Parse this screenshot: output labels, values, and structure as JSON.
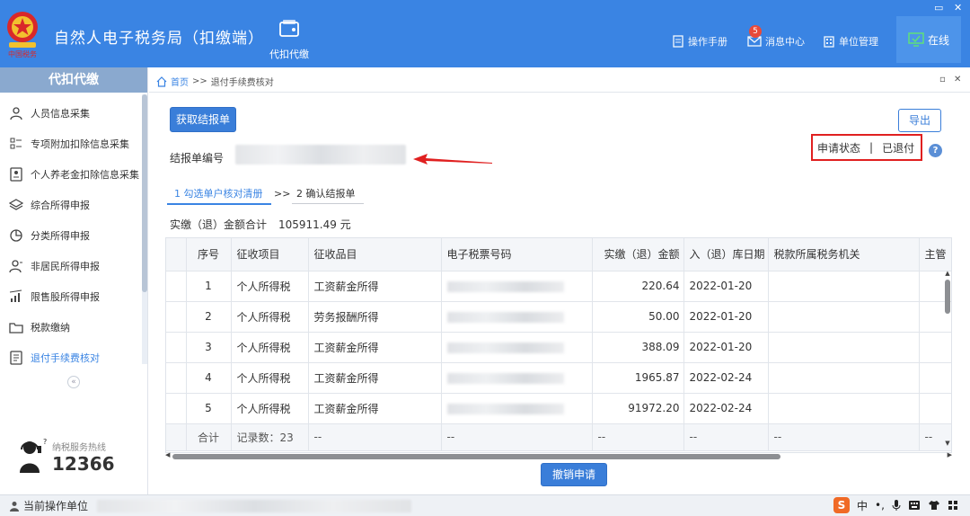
{
  "header": {
    "app_title": "自然人电子税务局（扣缴端）",
    "main_nav_label": "代扣代缴",
    "links": {
      "manual": "操作手册",
      "messages": "消息中心",
      "unit_mgmt": "单位管理"
    },
    "message_badge": "5",
    "online": "在线",
    "logo_text": "中国税务"
  },
  "sidebar": {
    "title": "代扣代缴",
    "items": [
      {
        "label": "人员信息采集"
      },
      {
        "label": "专项附加扣除信息采集"
      },
      {
        "label": "个人养老金扣除信息采集"
      },
      {
        "label": "综合所得申报"
      },
      {
        "label": "分类所得申报"
      },
      {
        "label": "非居民所得申报"
      },
      {
        "label": "限售股所得申报"
      },
      {
        "label": "税款缴纳"
      },
      {
        "label": "退付手续费核对"
      }
    ],
    "collapse": "«",
    "hotline_label": "纳税服务热线",
    "hotline_number": "12366"
  },
  "breadcrumb": {
    "home": "首页",
    "sep": ">>",
    "current": "退付手续费核对"
  },
  "main": {
    "get_statement_btn": "获取结报单",
    "export_btn": "导出",
    "statement_no_label": "结报单编号",
    "status_label": "申请状态",
    "status_sep": "|",
    "status_value": "已退付",
    "help": "?",
    "steps": [
      {
        "label": "1 勾选单户核对清册"
      },
      {
        "label": "2 确认结报单"
      }
    ],
    "steps_sep": ">>",
    "total_label": "实缴（退）金额合计",
    "total_value": "105911.49 元",
    "cancel_btn": "撤销申请"
  },
  "table": {
    "columns": [
      "序号",
      "征收项目",
      "征收品目",
      "电子税票号码",
      "实缴（退）金额",
      "入（退）库日期",
      "税款所属税务机关",
      "主管"
    ],
    "rows": [
      {
        "no": "1",
        "item": "个人所得税",
        "category": "工资薪金所得",
        "amount": "220.64",
        "date": "2022-01-20"
      },
      {
        "no": "2",
        "item": "个人所得税",
        "category": "劳务报酬所得",
        "amount": "50.00",
        "date": "2022-01-20"
      },
      {
        "no": "3",
        "item": "个人所得税",
        "category": "工资薪金所得",
        "amount": "388.09",
        "date": "2022-01-20"
      },
      {
        "no": "4",
        "item": "个人所得税",
        "category": "工资薪金所得",
        "amount": "1965.87",
        "date": "2022-02-24"
      },
      {
        "no": "5",
        "item": "个人所得税",
        "category": "工资薪金所得",
        "amount": "91972.20",
        "date": "2022-02-24"
      }
    ],
    "footer": {
      "label": "合计",
      "count": "记录数：23",
      "dash": "--"
    }
  },
  "statusbar": {
    "label": "当前操作单位"
  },
  "ime": {
    "logo": "S",
    "lang": "中"
  },
  "colors": {
    "header_bg": "#3a84e3",
    "accent": "#3a7ed9",
    "status_border": "#e02020"
  }
}
